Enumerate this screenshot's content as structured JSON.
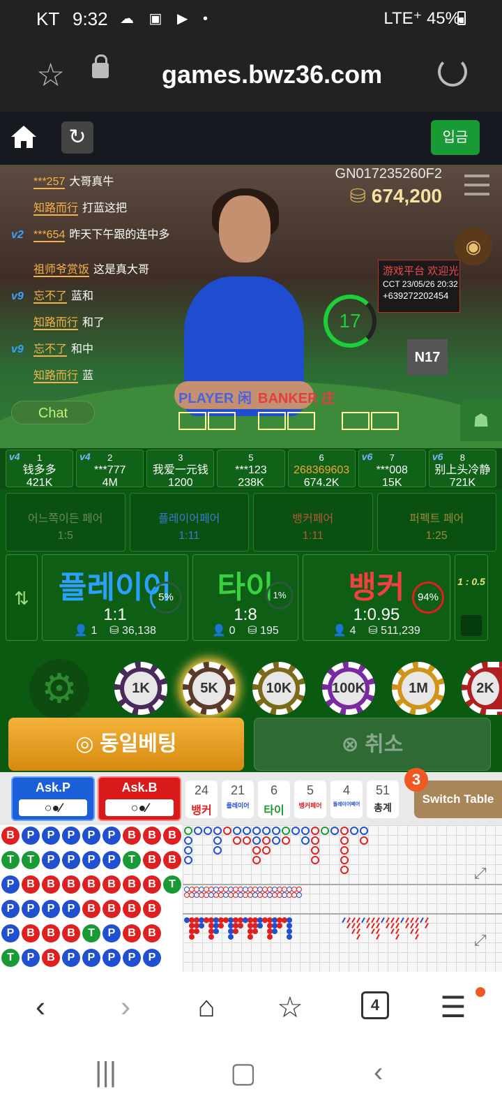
{
  "status": {
    "carrier": "KT",
    "time": "9:32",
    "right": "LTE⁺ 45%"
  },
  "browser": {
    "url": "games.bwz36.com"
  },
  "header": {
    "deposit_label": "입금"
  },
  "video": {
    "game_id": "GN017235260F2",
    "balance": "674,200",
    "timer": "17",
    "shoe_tag": "N17",
    "sign": {
      "l1": "游戏平台 欢迎光",
      "l2": "CCT 23/05/26 20:32",
      "l3": "+639272202454"
    },
    "player_label": "PLAYER 闲",
    "banker_label": "BANKER 庄",
    "chat_label": "Chat",
    "chat": [
      {
        "lv": "",
        "name": "***257",
        "msg": "大哥真牛"
      },
      {
        "lv": "",
        "name": "知路而行",
        "msg": "打蓝这把"
      },
      {
        "lv": "v2",
        "name": "***654",
        "msg": "昨天下午跟的连中多"
      },
      {
        "lv": "",
        "name": "祖师爷赏饭",
        "msg": "这是真大哥"
      },
      {
        "lv": "v9",
        "name": "忘不了",
        "msg": "蓝和"
      },
      {
        "lv": "",
        "name": "知路而行",
        "msg": "和了"
      },
      {
        "lv": "v9",
        "name": "忘不了",
        "msg": "和中"
      },
      {
        "lv": "",
        "name": "知路而行",
        "msg": "蓝"
      }
    ]
  },
  "seats": [
    {
      "lv": "v4",
      "no": "1",
      "name": "钱多多",
      "amt": "421K"
    },
    {
      "lv": "v4",
      "no": "2",
      "name": "***777",
      "amt": "4M"
    },
    {
      "lv": "",
      "no": "3",
      "name": "我爱一元钱",
      "amt": "1200"
    },
    {
      "lv": "",
      "no": "5",
      "name": "***123",
      "amt": "238K"
    },
    {
      "lv": "",
      "no": "6",
      "name": "268369603",
      "amt": "674.2K"
    },
    {
      "lv": "v6",
      "no": "7",
      "name": "***008",
      "amt": "15K"
    },
    {
      "lv": "v6",
      "no": "8",
      "name": "别上头冷静",
      "amt": "721K"
    }
  ],
  "pairs": [
    {
      "label": "어느쪽이든 페어",
      "odds": "1:5"
    },
    {
      "label": "플레이어페어",
      "odds": "1:11"
    },
    {
      "label": "뱅커페어",
      "odds": "1:11"
    },
    {
      "label": "퍼펙트 페어",
      "odds": "1:25"
    }
  ],
  "main_bets": {
    "player": {
      "label": "플레이어",
      "odds": "1:1",
      "pct": "5%",
      "users": "1",
      "amount": "36,138"
    },
    "tie": {
      "label": "타이",
      "odds": "1:8",
      "pct": "1%",
      "users": "0",
      "amount": "195"
    },
    "banker": {
      "label": "뱅커",
      "odds": "1:0.95",
      "pct": "94%",
      "users": "4",
      "amount": "511,239"
    },
    "extra_odds": "1 : 0.5"
  },
  "chips": [
    "1K",
    "5K",
    "10K",
    "100K",
    "1M",
    "2K"
  ],
  "actions": {
    "same_bet": "동일베팅",
    "cancel": "취소"
  },
  "roads": {
    "ask_p": "Ask.P",
    "ask_b": "Ask.B",
    "tallies": [
      {
        "count": "24",
        "label": "뱅커",
        "color": "#e02020"
      },
      {
        "count": "21",
        "label": "플레이어",
        "color": "#2050d0"
      },
      {
        "count": "6",
        "label": "타이",
        "color": "#1a9a34"
      },
      {
        "count": "5",
        "label": "뱅커페어",
        "color": "#e02020"
      },
      {
        "count": "4",
        "label": "플레이어페어",
        "color": "#2050d0"
      },
      {
        "count": "51",
        "label": "총계",
        "color": "#333"
      }
    ],
    "badge": "3",
    "switch_label": "Switch Table",
    "bead": [
      [
        "B",
        "T",
        "P",
        "P",
        "P",
        "T"
      ],
      [
        "P",
        "T",
        "B",
        "P",
        "B",
        "P"
      ],
      [
        "P",
        "P",
        "B",
        "P",
        "B",
        "B"
      ],
      [
        "P",
        "P",
        "B",
        "P",
        "B",
        "P"
      ],
      [
        "P",
        "P",
        "B",
        "B",
        "T",
        "P"
      ],
      [
        "P",
        "P",
        "B",
        "B",
        "P",
        "P"
      ],
      [
        "B",
        "T",
        "B",
        "B",
        "B",
        "P"
      ],
      [
        "B",
        "B",
        "B",
        "B",
        "B",
        "P"
      ],
      [
        "B",
        "B",
        "T",
        "",
        "",
        ""
      ]
    ]
  },
  "nav": {
    "tabs_count": "4"
  },
  "colors": {
    "banker": "#e02020",
    "player": "#2050d0",
    "tie": "#1a9a34",
    "accent": "#1a9a34"
  }
}
